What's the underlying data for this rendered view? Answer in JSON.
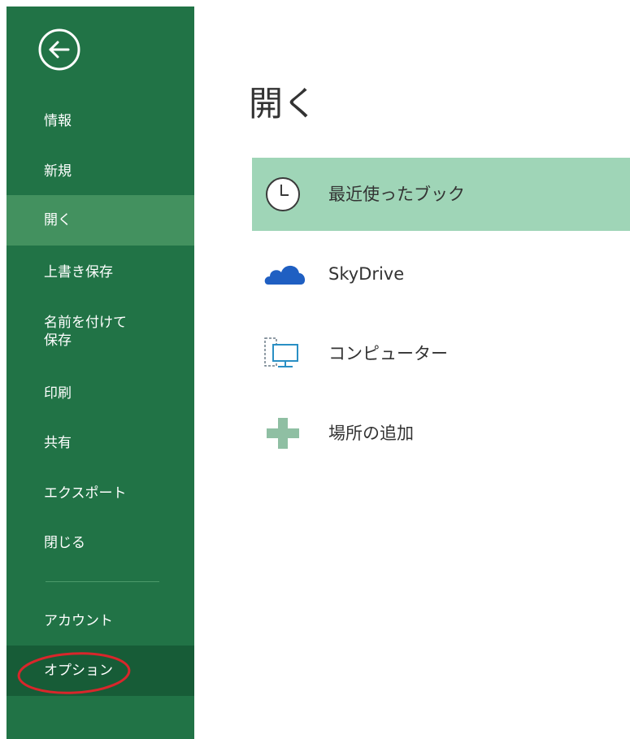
{
  "sidebar": {
    "back_icon": "back-arrow-icon",
    "items": [
      {
        "label": "情報"
      },
      {
        "label": "新規"
      },
      {
        "label": "開く"
      },
      {
        "label": "上書き保存"
      },
      {
        "label": "名前を付けて\n保存"
      },
      {
        "label": "印刷"
      },
      {
        "label": "共有"
      },
      {
        "label": "エクスポート"
      },
      {
        "label": "閉じる"
      },
      {
        "label": "アカウント"
      },
      {
        "label": "オプション"
      }
    ],
    "active_item": "開く",
    "highlighted_item": "オプション"
  },
  "main": {
    "title": "開く",
    "locations": [
      {
        "label": "最近使ったブック",
        "icon": "clock-icon",
        "selected": true
      },
      {
        "label": "SkyDrive",
        "icon": "cloud-icon",
        "selected": false
      },
      {
        "label": "コンピューター",
        "icon": "computer-icon",
        "selected": false
      },
      {
        "label": "場所の追加",
        "icon": "plus-icon",
        "selected": false
      }
    ]
  },
  "colors": {
    "sidebar_bg": "#217346",
    "sidebar_active": "#43915f",
    "sidebar_options": "#175c37",
    "selected_location": "#9fd5b7",
    "annotation_circle": "#d9262b",
    "cloud": "#1f5fc2",
    "plus": "#8fbfa3"
  }
}
